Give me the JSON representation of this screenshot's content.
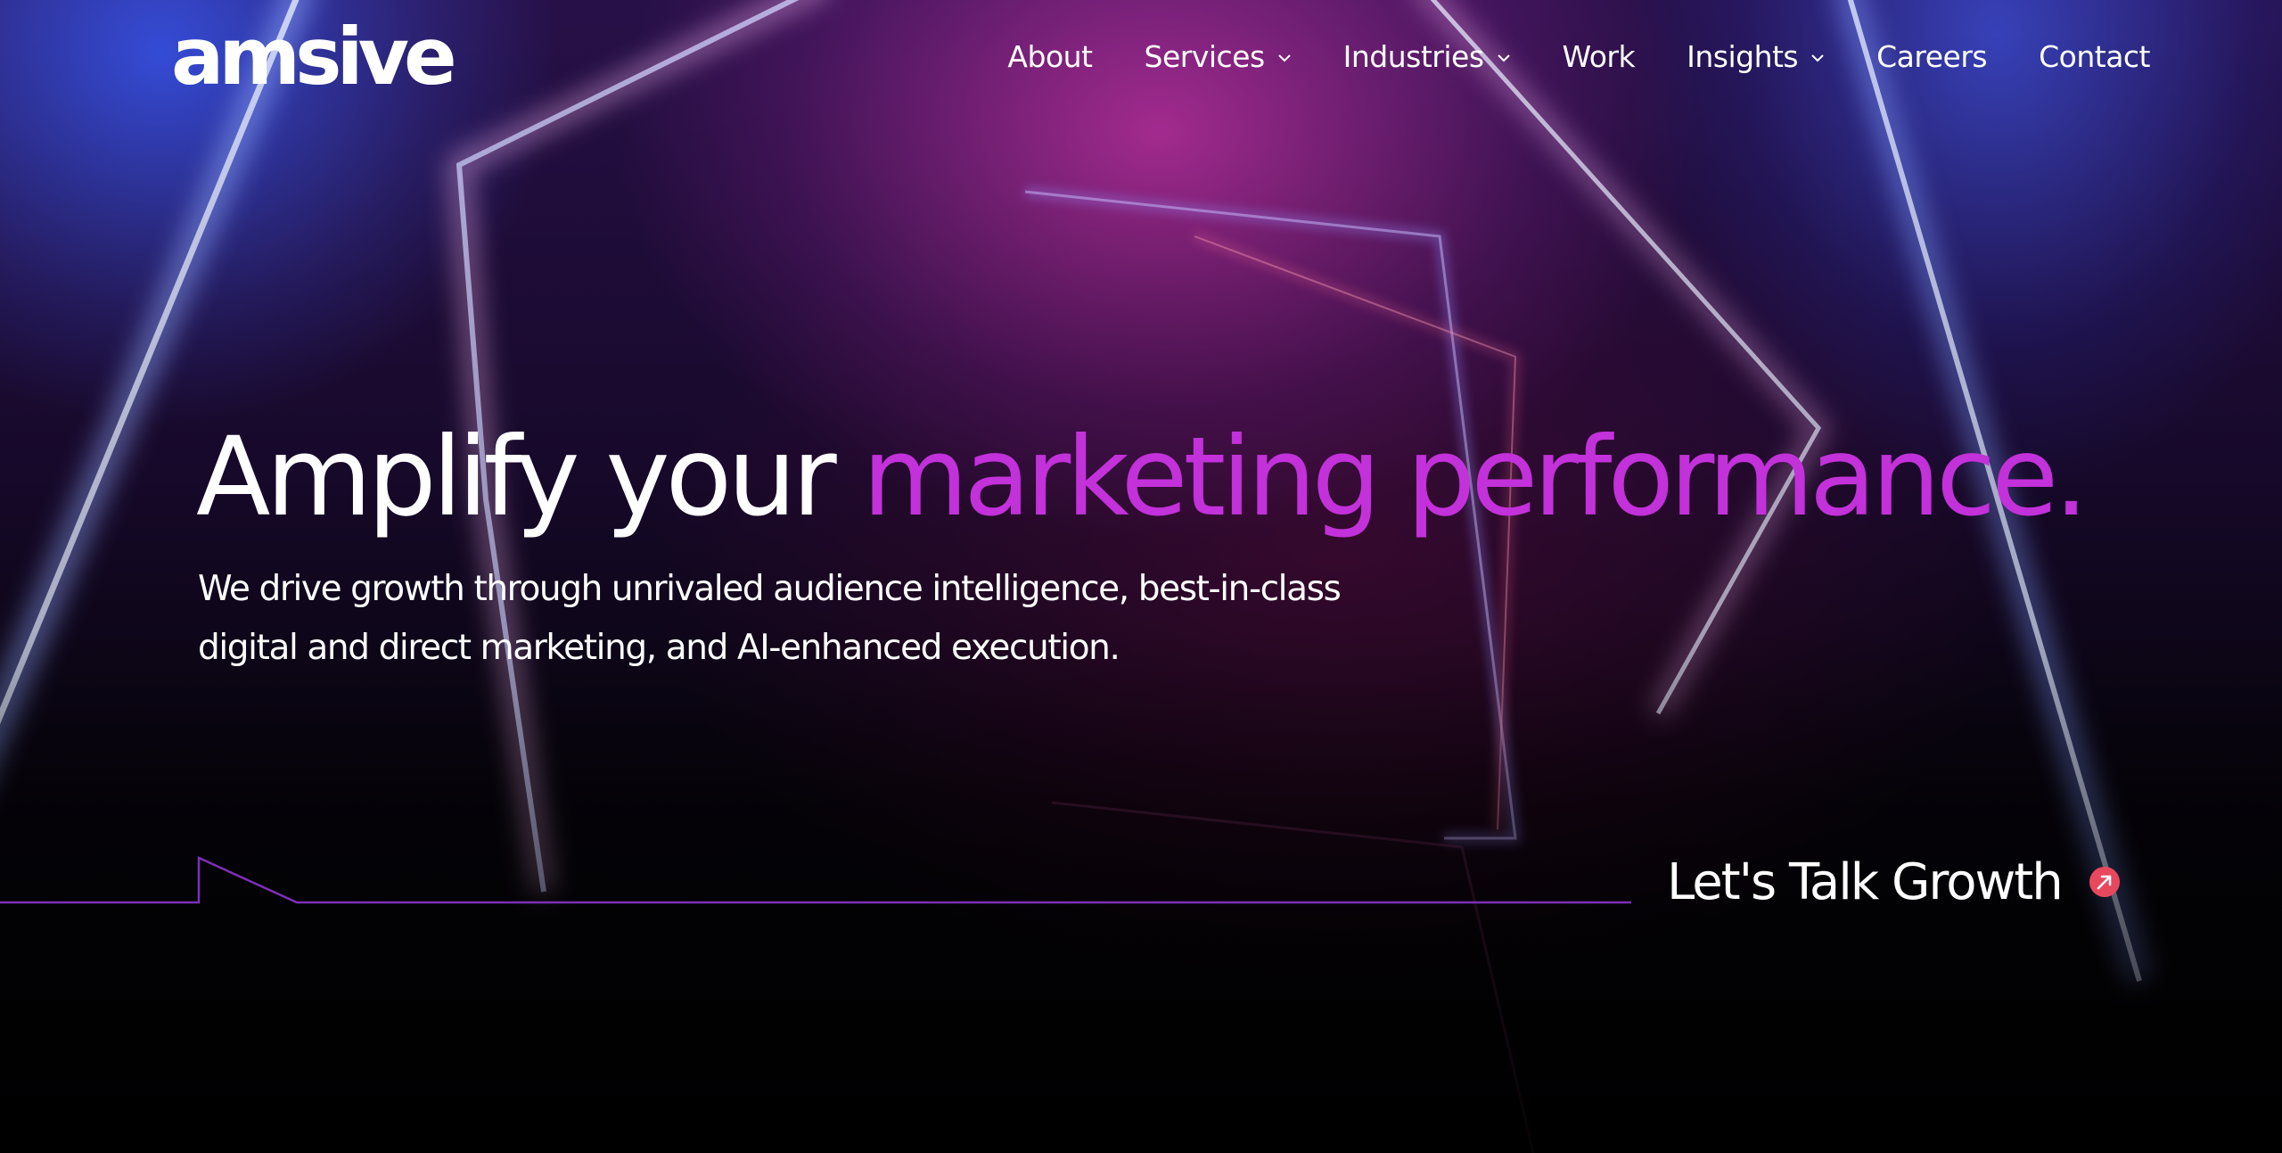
{
  "brand": {
    "logo_text": "amsive",
    "accent_color": "#c231d9",
    "cta_icon_color": "#e8485e"
  },
  "nav": {
    "items": [
      {
        "label": "About",
        "has_dropdown": false
      },
      {
        "label": "Services",
        "has_dropdown": true
      },
      {
        "label": "Industries",
        "has_dropdown": true
      },
      {
        "label": "Work",
        "has_dropdown": false
      },
      {
        "label": "Insights",
        "has_dropdown": true
      },
      {
        "label": "Careers",
        "has_dropdown": false
      },
      {
        "label": "Contact",
        "has_dropdown": false
      }
    ]
  },
  "hero": {
    "title_plain": "Amplify your ",
    "title_accent": "marketing performance.",
    "subtitle": "We drive growth through unrivaled audience intelligence, best-in-class digital and direct marketing, and AI-enhanced execution."
  },
  "cta": {
    "label": "Let's Talk Growth",
    "icon": "arrow-up-right-circle-icon"
  }
}
